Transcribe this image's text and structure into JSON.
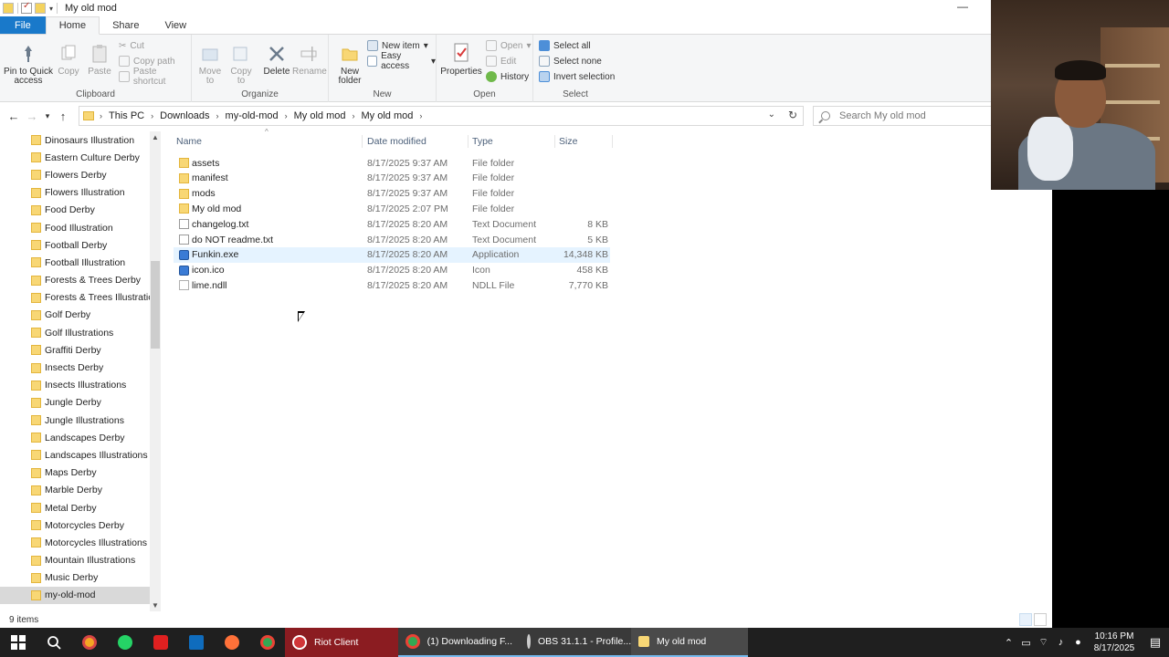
{
  "window": {
    "title": "My old mod"
  },
  "ribbon_tabs": [
    "File",
    "Home",
    "Share",
    "View"
  ],
  "ribbon": {
    "clipboard": {
      "label": "Clipboard",
      "pin": "Pin to Quick access",
      "copy": "Copy",
      "paste": "Paste",
      "cut": "Cut",
      "copy_path": "Copy path",
      "paste_shortcut": "Paste shortcut"
    },
    "organize": {
      "label": "Organize",
      "move_to": "Move to",
      "copy_to": "Copy to",
      "delete": "Delete",
      "rename": "Rename"
    },
    "new": {
      "label": "New",
      "new_folder": "New folder",
      "new_item": "New item",
      "easy_access": "Easy access"
    },
    "open": {
      "label": "Open",
      "properties": "Properties",
      "open": "Open",
      "edit": "Edit",
      "history": "History"
    },
    "select": {
      "label": "Select",
      "select_all": "Select all",
      "select_none": "Select none",
      "invert": "Invert selection"
    }
  },
  "address": {
    "crumbs": [
      "This PC",
      "Downloads",
      "my-old-mod",
      "My old mod",
      "My old mod"
    ]
  },
  "search": {
    "placeholder": "Search My old mod"
  },
  "nav_items": [
    "Dinosaurs Illustration",
    "Eastern Culture Derby",
    "Flowers Derby",
    "Flowers Illustration",
    "Food Derby",
    "Food Illustration",
    "Football Derby",
    "Football Illustration",
    "Forests & Trees Derby",
    "Forests & Trees Illustrations",
    "Golf Derby",
    "Golf Illustrations",
    "Graffiti Derby",
    "Insects Derby",
    "Insects Illustrations",
    "Jungle Derby",
    "Jungle Illustrations",
    "Landscapes Derby",
    "Landscapes Illustrations",
    "Maps Derby",
    "Marble Derby",
    "Metal Derby",
    "Motorcycles Derby",
    "Motorcycles Illustrations",
    "Mountain Illustrations",
    "Music Derby",
    "my-old-mod"
  ],
  "columns": {
    "name": "Name",
    "date": "Date modified",
    "type": "Type",
    "size": "Size"
  },
  "files": [
    {
      "name": "assets",
      "date": "8/17/2025 9:37 AM",
      "type": "File folder",
      "size": "",
      "icon": "folder"
    },
    {
      "name": "manifest",
      "date": "8/17/2025 9:37 AM",
      "type": "File folder",
      "size": "",
      "icon": "folder"
    },
    {
      "name": "mods",
      "date": "8/17/2025 9:37 AM",
      "type": "File folder",
      "size": "",
      "icon": "folder"
    },
    {
      "name": "My old mod",
      "date": "8/17/2025 2:07 PM",
      "type": "File folder",
      "size": "",
      "icon": "folder"
    },
    {
      "name": "changelog.txt",
      "date": "8/17/2025 8:20 AM",
      "type": "Text Document",
      "size": "8 KB",
      "icon": "text"
    },
    {
      "name": "do NOT readme.txt",
      "date": "8/17/2025 8:20 AM",
      "type": "Text Document",
      "size": "5 KB",
      "icon": "text"
    },
    {
      "name": "Funkin.exe",
      "date": "8/17/2025 8:20 AM",
      "type": "Application",
      "size": "14,348 KB",
      "icon": "app"
    },
    {
      "name": "icon.ico",
      "date": "8/17/2025 8:20 AM",
      "type": "Icon",
      "size": "458 KB",
      "icon": "app"
    },
    {
      "name": "lime.ndll",
      "date": "8/17/2025 8:20 AM",
      "type": "NDLL File",
      "size": "7,770 KB",
      "icon": "file"
    }
  ],
  "status": {
    "items": "9 items"
  },
  "taskbar": {
    "riot": "Riot Client",
    "chrome": "(1) Downloading F...",
    "obs": "OBS 31.1.1 - Profile...",
    "explorer": "My old mod",
    "time": "10:16 PM",
    "date": "8/17/2025"
  }
}
